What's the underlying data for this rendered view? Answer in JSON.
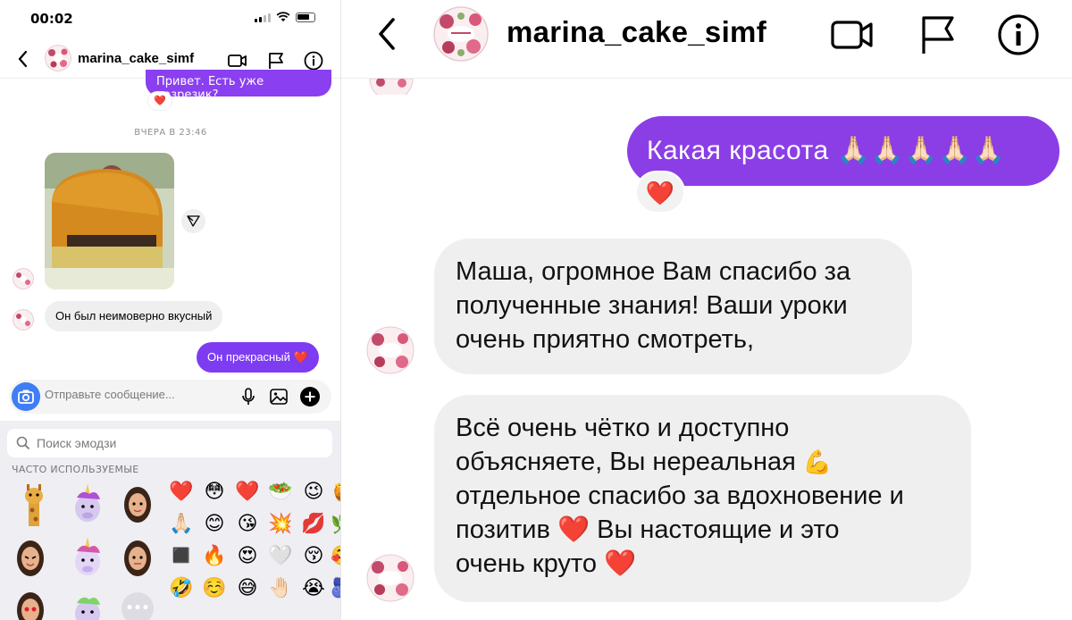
{
  "status_bar": {
    "time": "00:02"
  },
  "profile": {
    "username": "marina_cake_simf"
  },
  "left_chat": {
    "partial_message": "Привет. Есть уже разрезик?",
    "reaction": "❤️",
    "day_label": "ВЧЕРА В 23:46",
    "incoming_message": "Он был неимоверно вкусный",
    "outgoing_message": "Он прекрасный ❤️"
  },
  "composer": {
    "placeholder": "Отправьте сообщение..."
  },
  "emoji_keyboard": {
    "search_placeholder": "Поиск эмодзи",
    "section_label": "ЧАСТО ИСПОЛЬЗУЕМЫЕ",
    "rows": [
      [
        "❤️",
        "😳",
        "❤️",
        "🥗",
        "😉",
        "🍯"
      ],
      [
        "🙏🏻",
        "😊",
        "😘",
        "💥",
        "💋",
        "🌿"
      ],
      [
        "◼️",
        "🔥",
        "😍",
        "🤍",
        "😚",
        "🥰"
      ],
      [
        "🤣",
        "☺️",
        "😅",
        "🤚🏻",
        "😭",
        "🫐"
      ]
    ],
    "more_button": "•••"
  },
  "right_chat": {
    "outgoing_message": "Какая красота 🙏🏻🙏🏻🙏🏻🙏🏻🙏🏻",
    "reaction": "❤️",
    "message1_lines": [
      "Маша, огромное Вам спасибо за",
      "полученные знания! Ваши уроки",
      "очень приятно смотреть,"
    ],
    "message2_line1": "Всё очень чётко и доступно",
    "message2_line2": "объясняете, Вы нереальная",
    "message2_muscle": "💪",
    "message2_line3": "отдельное спасибо за вдохновение и",
    "message2_line4a": "позитив",
    "message2_heart": "❤️",
    "message2_line4b": "Вы настоящие и это",
    "message2_line5": "очень круто",
    "message2_heart2": "❤️"
  },
  "colors": {
    "accent_purple": "#8b3ee6",
    "bubble_gray": "#efefef",
    "heart_red": "#e5202a",
    "camera_blue": "#3f7ef6"
  }
}
